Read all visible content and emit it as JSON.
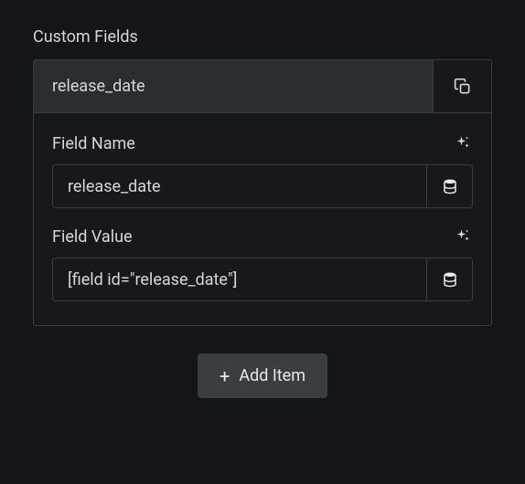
{
  "section": {
    "title": "Custom Fields"
  },
  "item": {
    "header_title": "release_date",
    "fields": {
      "name": {
        "label": "Field Name",
        "value": "release_date"
      },
      "value": {
        "label": "Field Value",
        "value": "[field id=\"release_date\"]"
      }
    }
  },
  "actions": {
    "add_item": "Add Item"
  }
}
